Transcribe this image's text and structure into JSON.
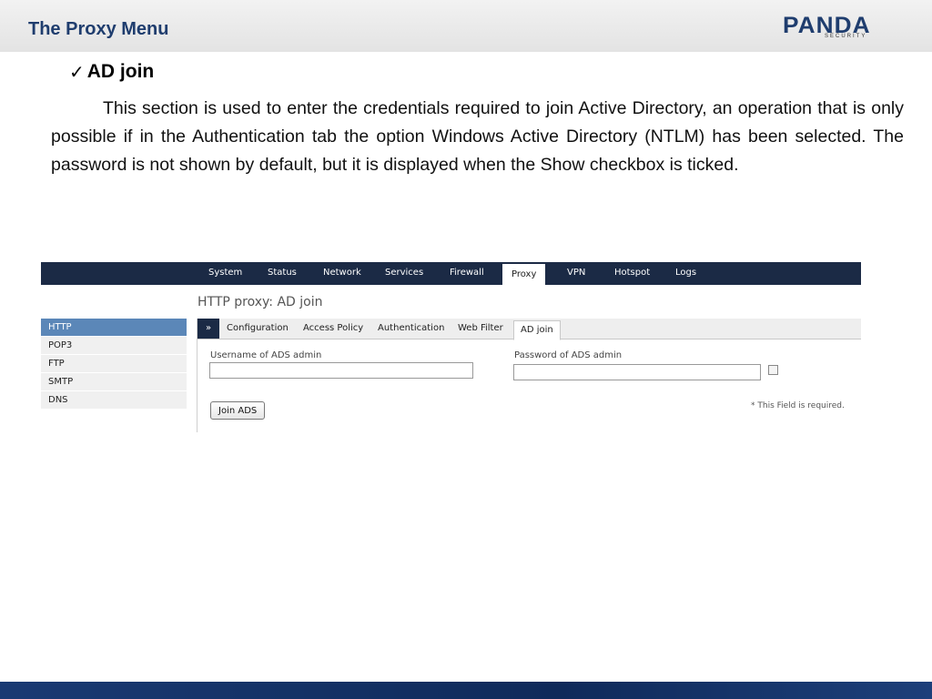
{
  "slide": {
    "title": "The Proxy Menu",
    "logo": {
      "main": "PANDA",
      "sub": "SECURITY"
    },
    "bullet": {
      "icon": "check-icon",
      "glyph": "✓",
      "title": "AD join"
    },
    "body": "This section is used to enter the credentials required to join Active Directory, an operation that is only possible if in the Authentication tab the option Windows Active Directory (NTLM) has been selected. The password is not shown by default, but it is displayed when the Show checkbox is ticked."
  },
  "ui": {
    "topnav": [
      "System",
      "Status",
      "Network",
      "Services",
      "Firewall",
      "Proxy",
      "VPN",
      "Hotspot",
      "Logs"
    ],
    "active_nav": "Proxy",
    "page_heading": "HTTP proxy: AD join",
    "sidebar": [
      "HTTP",
      "POP3",
      "FTP",
      "SMTP",
      "DNS"
    ],
    "active_sidebar": "HTTP",
    "tabs": {
      "arrow": "»",
      "items": [
        "Configuration",
        "Access Policy",
        "Authentication",
        "Web Filter",
        "AD join"
      ],
      "active": "AD join"
    },
    "form": {
      "username_label": "Username of ADS admin",
      "username_value": "",
      "password_label": "Password of ADS admin",
      "password_value": "",
      "show_checked": false,
      "join_button": "Join ADS",
      "required_note": "* This Field is required."
    }
  },
  "colors": {
    "title": "#1f3d6e",
    "nav_bg": "#1b2a45",
    "sidebar_active": "#5b87b8",
    "footer": "#1a3a73"
  }
}
